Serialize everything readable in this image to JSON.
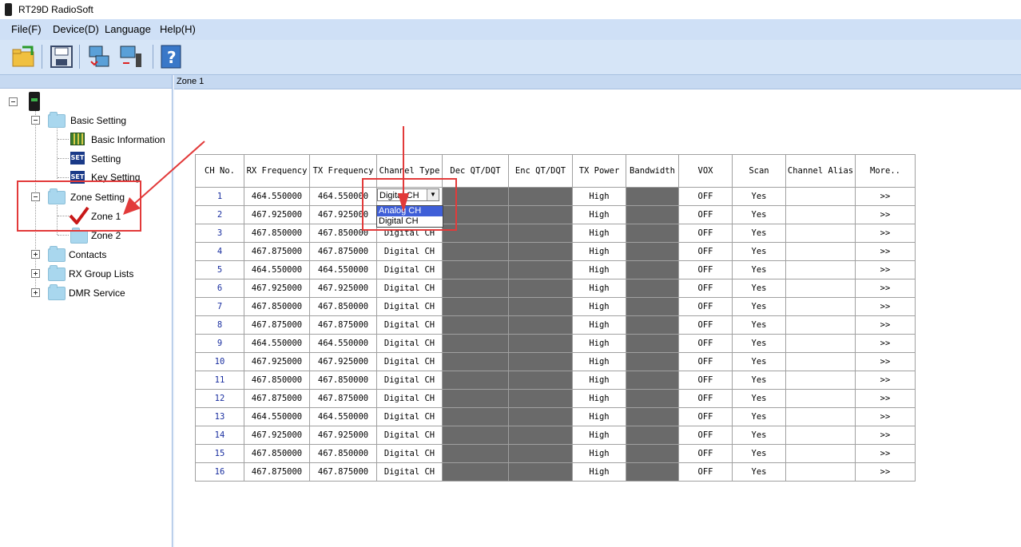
{
  "window": {
    "title": "RT29D RadioSoft"
  },
  "menu": [
    {
      "label": "File(F)"
    },
    {
      "label": "Device(D)"
    },
    {
      "label": "Language"
    },
    {
      "label": "Help(H)"
    }
  ],
  "toolbar": {
    "buttons": [
      {
        "name": "open-icon"
      },
      {
        "name": "save-icon"
      },
      {
        "name": "read-radio-icon"
      },
      {
        "name": "write-radio-icon"
      },
      {
        "name": "help-icon"
      }
    ]
  },
  "tree": {
    "root": {
      "icon": "radio-icon"
    },
    "items": [
      {
        "label": "Basic Setting"
      },
      {
        "label": "Basic Information"
      },
      {
        "label": "Setting",
        "icon_text": "SET"
      },
      {
        "label": "Key Setting",
        "icon_text": "SET"
      },
      {
        "label": "Zone Setting"
      },
      {
        "label": "Zone 1"
      },
      {
        "label": "Zone 2"
      },
      {
        "label": "Contacts"
      },
      {
        "label": "RX Group Lists"
      },
      {
        "label": "DMR Service"
      }
    ]
  },
  "tab": {
    "title": "Zone 1"
  },
  "table": {
    "headers": [
      "CH No.",
      "RX Frequency",
      "TX Frequency",
      "Channel Type",
      "Dec QT/DQT",
      "Enc QT/DQT",
      "TX Power",
      "Bandwidth",
      "VOX",
      "Scan",
      "Channel Alias",
      "More.."
    ],
    "rows": [
      [
        "1",
        "464.550000",
        "464.550000",
        "Digital CH",
        "",
        "",
        "High",
        "",
        "OFF",
        "Yes",
        "",
        ">>"
      ],
      [
        "2",
        "467.925000",
        "467.925000",
        "Digital CH",
        "",
        "",
        "High",
        "",
        "OFF",
        "Yes",
        "",
        ">>"
      ],
      [
        "3",
        "467.850000",
        "467.850000",
        "Digital CH",
        "",
        "",
        "High",
        "",
        "OFF",
        "Yes",
        "",
        ">>"
      ],
      [
        "4",
        "467.875000",
        "467.875000",
        "Digital CH",
        "",
        "",
        "High",
        "",
        "OFF",
        "Yes",
        "",
        ">>"
      ],
      [
        "5",
        "464.550000",
        "464.550000",
        "Digital CH",
        "",
        "",
        "High",
        "",
        "OFF",
        "Yes",
        "",
        ">>"
      ],
      [
        "6",
        "467.925000",
        "467.925000",
        "Digital CH",
        "",
        "",
        "High",
        "",
        "OFF",
        "Yes",
        "",
        ">>"
      ],
      [
        "7",
        "467.850000",
        "467.850000",
        "Digital CH",
        "",
        "",
        "High",
        "",
        "OFF",
        "Yes",
        "",
        ">>"
      ],
      [
        "8",
        "467.875000",
        "467.875000",
        "Digital CH",
        "",
        "",
        "High",
        "",
        "OFF",
        "Yes",
        "",
        ">>"
      ],
      [
        "9",
        "464.550000",
        "464.550000",
        "Digital CH",
        "",
        "",
        "High",
        "",
        "OFF",
        "Yes",
        "",
        ">>"
      ],
      [
        "10",
        "467.925000",
        "467.925000",
        "Digital CH",
        "",
        "",
        "High",
        "",
        "OFF",
        "Yes",
        "",
        ">>"
      ],
      [
        "11",
        "467.850000",
        "467.850000",
        "Digital CH",
        "",
        "",
        "High",
        "",
        "OFF",
        "Yes",
        "",
        ">>"
      ],
      [
        "12",
        "467.875000",
        "467.875000",
        "Digital CH",
        "",
        "",
        "High",
        "",
        "OFF",
        "Yes",
        "",
        ">>"
      ],
      [
        "13",
        "464.550000",
        "464.550000",
        "Digital CH",
        "",
        "",
        "High",
        "",
        "OFF",
        "Yes",
        "",
        ">>"
      ],
      [
        "14",
        "467.925000",
        "467.925000",
        "Digital CH",
        "",
        "",
        "High",
        "",
        "OFF",
        "Yes",
        "",
        ">>"
      ],
      [
        "15",
        "467.850000",
        "467.850000",
        "Digital CH",
        "",
        "",
        "High",
        "",
        "OFF",
        "Yes",
        "",
        ">>"
      ],
      [
        "16",
        "467.875000",
        "467.875000",
        "Digital CH",
        "",
        "",
        "High",
        "",
        "OFF",
        "Yes",
        "",
        ">>"
      ]
    ]
  },
  "dropdown": {
    "value": "Digital CH",
    "options": [
      "Analog CH",
      "Digital CH"
    ],
    "highlighted": "Analog CH"
  },
  "colors": {
    "annotation": "#e23a3a",
    "disabled_cell": "#6a6a6a",
    "menu_bg": "#cfe0f6"
  }
}
